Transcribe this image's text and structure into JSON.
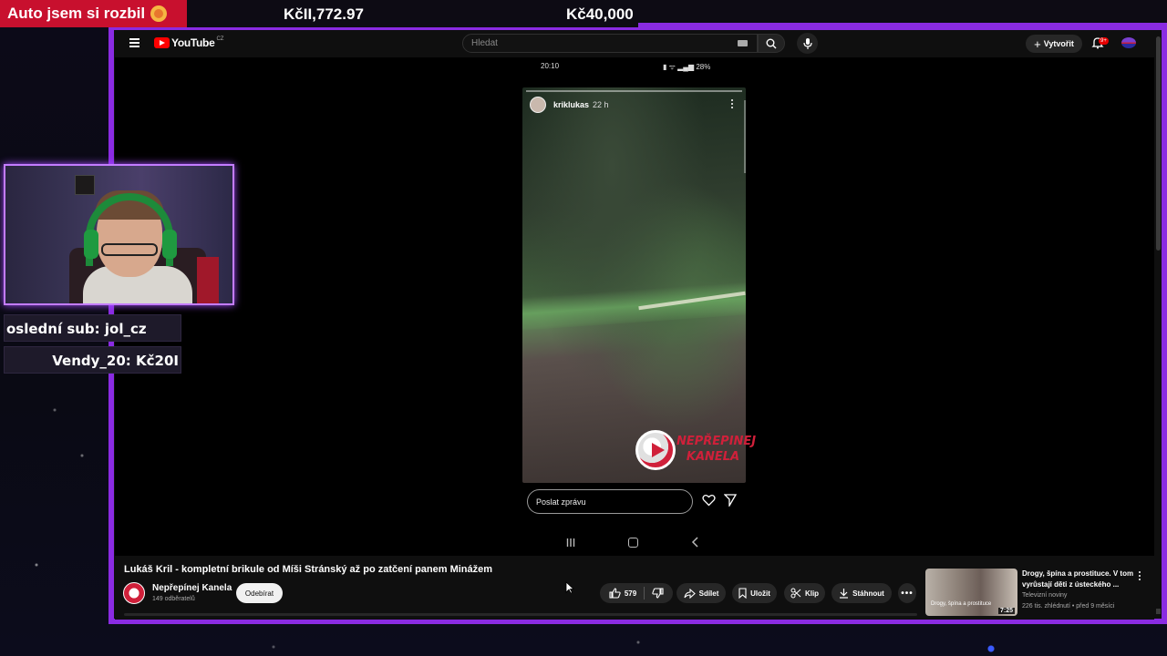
{
  "stream": {
    "alert_text": "Auto jsem si rozbil",
    "goal_amount_1": "KčII,772.97",
    "goal_amount_2": "Kč40,000",
    "last_sub": "oslední sub: jol_cz",
    "top_donor": "Vendy_20: Kč20I"
  },
  "youtube": {
    "logo_text": "YouTube",
    "country": "CZ",
    "search_placeholder": "Hledat",
    "create_label": "Vytvořit",
    "notifications_badge": "9+"
  },
  "story": {
    "phone_time": "20:10",
    "phone_status": "28%",
    "username": "kriklukas",
    "posted_ago": "22 h",
    "watermark_line1": "NEPŘEPINEJ",
    "watermark_line2": "KANELA",
    "message_placeholder": "Poslat zprávu"
  },
  "video": {
    "title": "Lukáš Kril - kompletní brikule od Míši Stránský až po zatčení panem Minážem",
    "channel_name": "Nepřepínej Kanela",
    "subscribers": "149 odběratelů",
    "subscribe_label": "Odebírat",
    "likes": "579",
    "share_label": "Sdílet",
    "save_label": "Uložit",
    "clip_label": "Klip",
    "download_label": "Stáhnout"
  },
  "recommendation": {
    "title": "Drogy, špína a prostituce. V tom vyrůstají děti z ústeckého ...",
    "channel": "Televizní noviny",
    "meta": "226 tis. zhlédnutí • před 9 měsíci",
    "duration": "7:25",
    "thumb_caption": "Drogy, špína a prostituce"
  },
  "colors": {
    "frame_purple": "#8a2be2",
    "alert_red": "#c8102e",
    "yt_red": "#ff0000"
  }
}
